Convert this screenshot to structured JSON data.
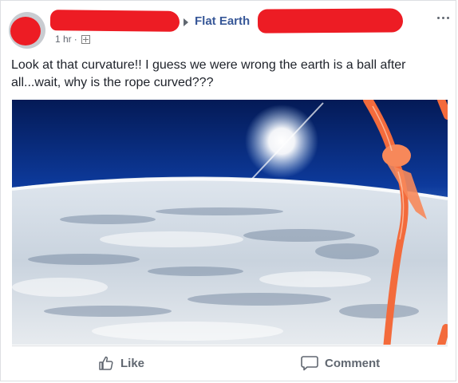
{
  "post": {
    "group_name": "Flat Earth",
    "time": "1 hr",
    "separator": "·",
    "text": "Look at that curvature!! I guess we were wrong the earth is a ball after all...wait, why is the rope curved???"
  },
  "actions": {
    "like_label": "Like",
    "comment_label": "Comment"
  },
  "icons": {
    "privacy": "group-audience-icon",
    "more": "more-options-icon",
    "like": "thumbs-up-icon",
    "comment": "comment-bubble-icon"
  },
  "colors": {
    "link": "#385898",
    "redaction": "#ed1c24",
    "rope": "#f36b3c"
  }
}
